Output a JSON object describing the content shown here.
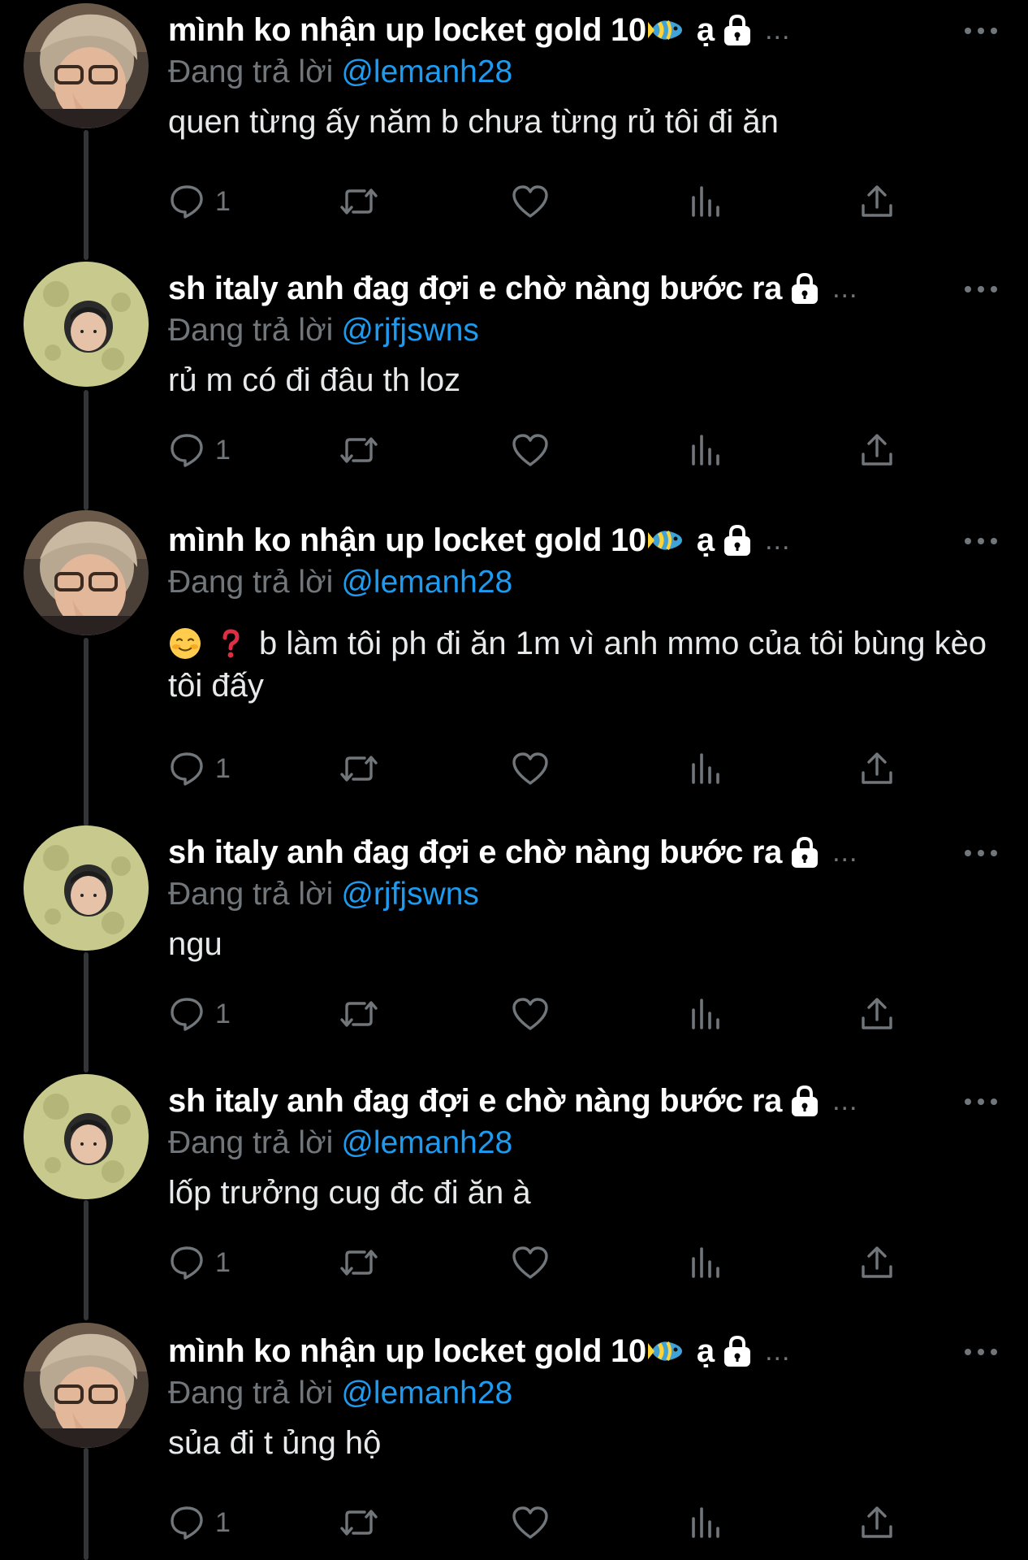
{
  "tweets": [
    {
      "author": "mình ko nhận up locket gold 10",
      "author_suffix": "ạ",
      "author_has_fish_emoji": true,
      "reply_prefix": "Đang trả lời",
      "reply_to": "@lemanh28",
      "text": "quen từng ấy năm b chưa từng rủ tôi đi ăn",
      "reply_count": "1",
      "avatar": "avatar-boy-glasses"
    },
    {
      "author": "sh italy anh đag đợi e chờ nàng bước ra",
      "author_suffix": "",
      "author_has_fish_emoji": false,
      "reply_prefix": "Đang trả lời",
      "reply_to": "@rjfjswns",
      "text": "rủ m có đi đâu th loz",
      "reply_count": "1",
      "avatar": "avatar-face-in-hole"
    },
    {
      "author": "mình ko nhận up locket gold 10",
      "author_suffix": "ạ",
      "author_has_fish_emoji": true,
      "reply_prefix": "Đang trả lời",
      "reply_to": "@lemanh28",
      "text": "b làm tôi ph đi ăn 1m vì anh mmo của tôi bùng kèo tôi đấy",
      "text_emojis": [
        "smiling-blush-emoji",
        "red-question-emoji"
      ],
      "reply_count": "1",
      "avatar": "avatar-boy-glasses"
    },
    {
      "author": "sh italy anh đag đợi e chờ nàng bước ra",
      "author_suffix": "",
      "author_has_fish_emoji": false,
      "reply_prefix": "Đang trả lời",
      "reply_to": "@rjfjswns",
      "text": "ngu",
      "reply_count": "1",
      "avatar": "avatar-face-in-hole"
    },
    {
      "author": "sh italy anh đag đợi e chờ nàng bước ra",
      "author_suffix": "",
      "author_has_fish_emoji": false,
      "reply_prefix": "Đang trả lời",
      "reply_to": "@lemanh28",
      "text": "lốp trưởng cug đc đi ăn à",
      "reply_count": "1",
      "avatar": "avatar-face-in-hole"
    },
    {
      "author": "mình ko nhận up locket gold 10",
      "author_suffix": "ạ",
      "author_has_fish_emoji": true,
      "reply_prefix": "Đang trả lời",
      "reply_to": "@lemanh28",
      "text": "sủa đi t ủng hộ",
      "reply_count": "1",
      "avatar": "avatar-boy-glasses"
    }
  ],
  "ellipsis": "...",
  "colors": {
    "background": "#000000",
    "name": "#ffffff",
    "text": "#e7e9ea",
    "muted": "#71767b",
    "mention": "#1d9bf0",
    "thread_line": "#333639"
  },
  "icons": {
    "reply": "reply-icon",
    "retweet": "retweet-icon",
    "like": "heart-icon",
    "views": "views-icon",
    "share": "share-icon",
    "more": "more-icon",
    "lock": "lock-icon"
  }
}
